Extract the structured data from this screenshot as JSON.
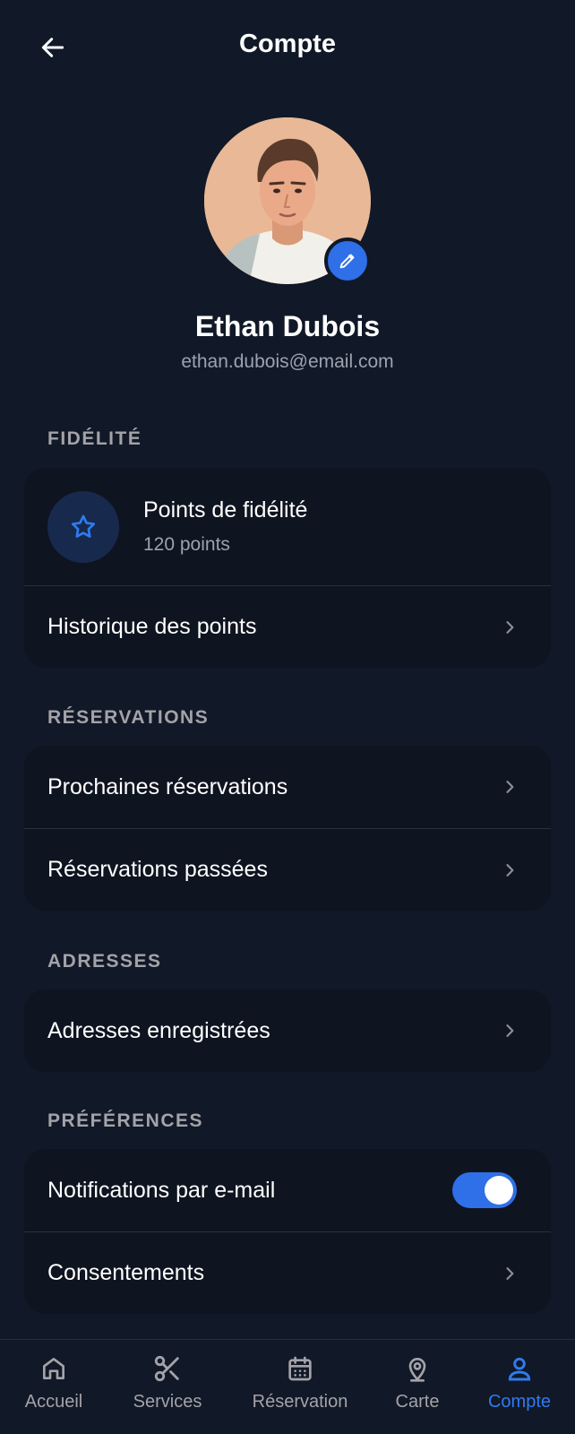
{
  "header": {
    "title": "Compte"
  },
  "profile": {
    "name": "Ethan Dubois",
    "email": "ethan.dubois@email.com"
  },
  "sections": {
    "loyalty": {
      "label": "FIDÉLITÉ",
      "points_title": "Points de fidélité",
      "points_value": "120 points",
      "history_label": "Historique des points"
    },
    "reservations": {
      "label": "RÉSERVATIONS",
      "upcoming_label": "Prochaines réservations",
      "past_label": "Réservations passées"
    },
    "addresses": {
      "label": "ADRESSES",
      "saved_label": "Adresses enregistrées"
    },
    "preferences": {
      "label": "PRÉFÉRENCES",
      "email_notifications_label": "Notifications par e-mail",
      "email_notifications_on": true,
      "consents_label": "Consentements"
    }
  },
  "nav": {
    "items": [
      {
        "label": "Accueil",
        "icon": "home-icon",
        "active": false
      },
      {
        "label": "Services",
        "icon": "scissors-icon",
        "active": false
      },
      {
        "label": "Réservation",
        "icon": "calendar-icon",
        "active": false
      },
      {
        "label": "Carte",
        "icon": "map-pin-icon",
        "active": false
      },
      {
        "label": "Compte",
        "icon": "user-icon",
        "active": true
      }
    ]
  },
  "colors": {
    "background": "#111827",
    "card": "#0e1420",
    "accent": "#2f6fe8",
    "muted_text": "#9ca3af"
  }
}
